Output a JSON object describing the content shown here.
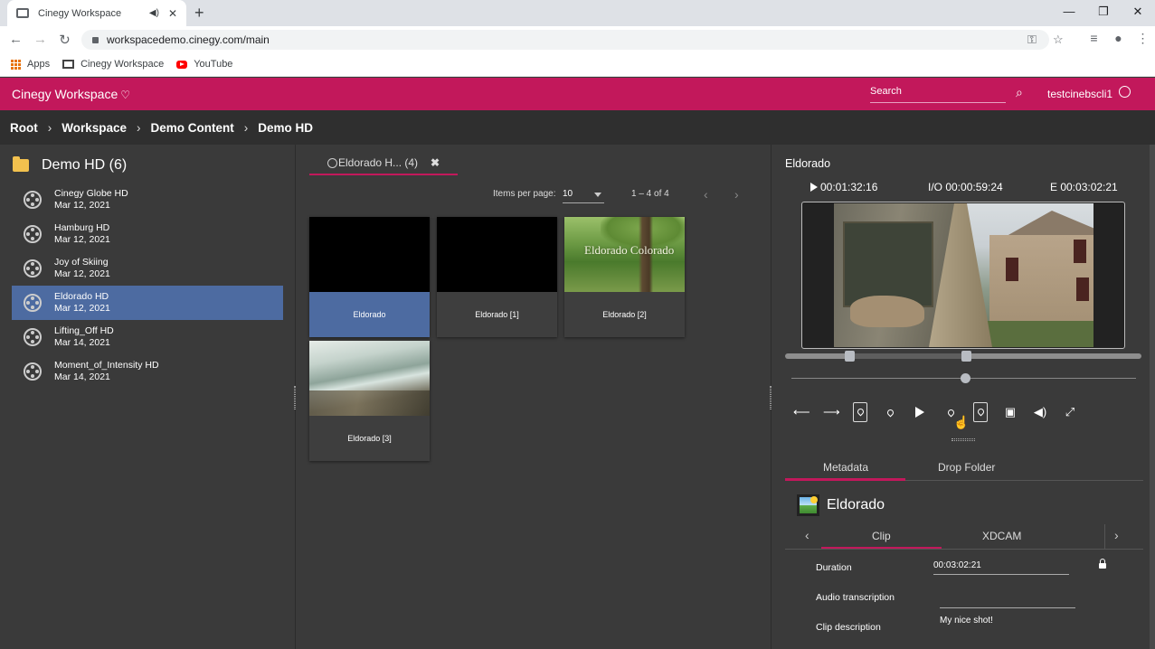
{
  "browser": {
    "tab_title": "Cinegy Workspace",
    "url": "workspacedemo.cinegy.com/main",
    "bookmarks": [
      "Apps",
      "Cinegy Workspace",
      "YouTube"
    ]
  },
  "app": {
    "brand": "Cinegy Workspace",
    "search_placeholder": "Search",
    "username": "testcinebscli1",
    "accent_color": "#c2185b"
  },
  "breadcrumb": [
    "Root",
    "Workspace",
    "Demo Content",
    "Demo HD"
  ],
  "sidebar": {
    "title": "Demo HD (6)",
    "items": [
      {
        "name": "Cinegy Globe HD",
        "date": "Mar 12, 2021"
      },
      {
        "name": "Hamburg HD",
        "date": "Mar 12, 2021"
      },
      {
        "name": "Joy of Skiing",
        "date": "Mar 12, 2021"
      },
      {
        "name": "Eldorado HD",
        "date": "Mar 12, 2021"
      },
      {
        "name": "Lifting_Off HD",
        "date": "Mar 14, 2021"
      },
      {
        "name": "Moment_of_Intensity HD",
        "date": "Mar 14, 2021"
      }
    ],
    "selected_index": 3
  },
  "middle": {
    "tab_label": "Eldorado H... (4)",
    "items_per_page_label": "Items per page:",
    "items_per_page": "10",
    "range": "1 – 4 of 4",
    "clips": [
      {
        "label": "Eldorado",
        "thumb": "black"
      },
      {
        "label": "Eldorado [1]",
        "thumb": "black"
      },
      {
        "label": "Eldorado [2]",
        "thumb": "forest",
        "overlay": "Eldorado Colorado"
      },
      {
        "label": "Eldorado [3]",
        "thumb": "river"
      }
    ]
  },
  "player": {
    "clip_name": "Eldorado",
    "position": "00:01:32:16",
    "io": "I/O 00:00:59:24",
    "end": "E 00:03:02:21"
  },
  "metadata": {
    "tabs": [
      "Metadata",
      "Drop Folder"
    ],
    "asset_title": "Eldorado",
    "subtabs": [
      "Clip",
      "XDCAM"
    ],
    "fields": [
      {
        "label": "Duration",
        "value": "00:03:02:21"
      },
      {
        "label": "Audio transcription",
        "value": ""
      },
      {
        "label": "Clip description",
        "value": "My nice shot!"
      }
    ]
  }
}
